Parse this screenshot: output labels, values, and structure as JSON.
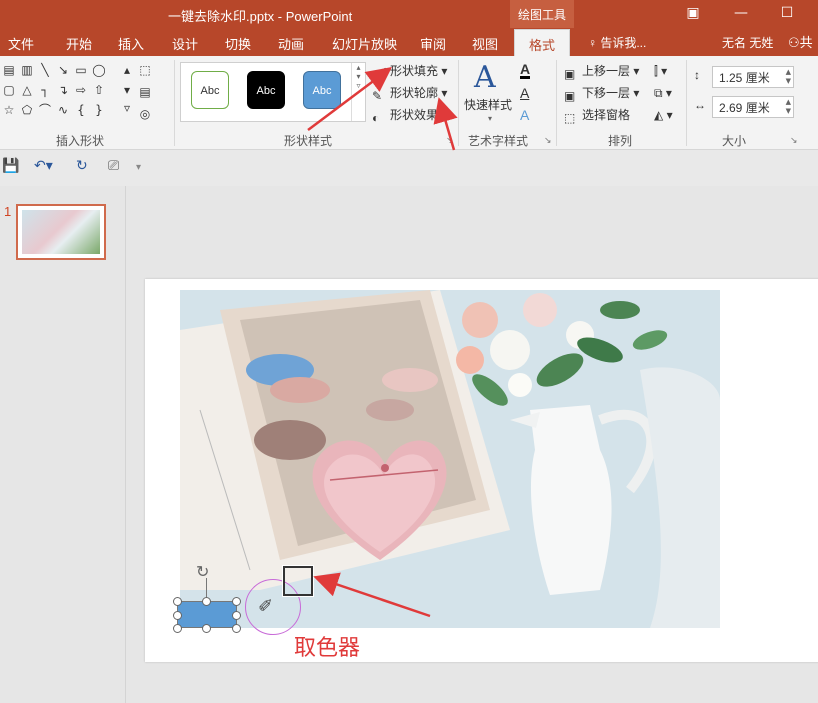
{
  "titlebar": {
    "title": "一键去除水印.pptx - PowerPoint",
    "context_tab": "绘图工具",
    "ribbon_display_icon": "ribbon-display-icon",
    "minimize_icon": "minimize-icon",
    "maximize_icon": "maximize-icon"
  },
  "tabs": [
    {
      "label": "文件"
    },
    {
      "label": "开始"
    },
    {
      "label": "插入"
    },
    {
      "label": "设计"
    },
    {
      "label": "切换"
    },
    {
      "label": "动画"
    },
    {
      "label": "幻灯片放映"
    },
    {
      "label": "审阅"
    },
    {
      "label": "视图"
    },
    {
      "label": "格式"
    }
  ],
  "active_tab": "格式",
  "tell_me": "告诉我...",
  "user_name": "无名 无姓",
  "share_label": "共",
  "ribbon": {
    "groups": {
      "insert_shapes": "插入形状",
      "shape_styles": "形状样式",
      "wordart_styles": "艺术字样式",
      "arrange": "排列",
      "size": "大小"
    },
    "style_swatches": [
      "Abc",
      "Abc",
      "Abc"
    ],
    "shape_fill": "形状填充",
    "shape_outline": "形状轮廓",
    "shape_effects": "形状效果",
    "quick_styles": "快速样式",
    "bring_forward": "上移一层",
    "send_backward": "下移一层",
    "selection_pane": "选择窗格",
    "height": "1.25 厘米",
    "width": "2.69 厘米"
  },
  "slides": {
    "number": "1"
  },
  "annotation": {
    "label": "取色器"
  },
  "colors": {
    "accent": "#b7472a",
    "selected_shape": "#5b9bd5",
    "annotation": "#e03a3a",
    "picker_ring": "#c86bd8"
  }
}
